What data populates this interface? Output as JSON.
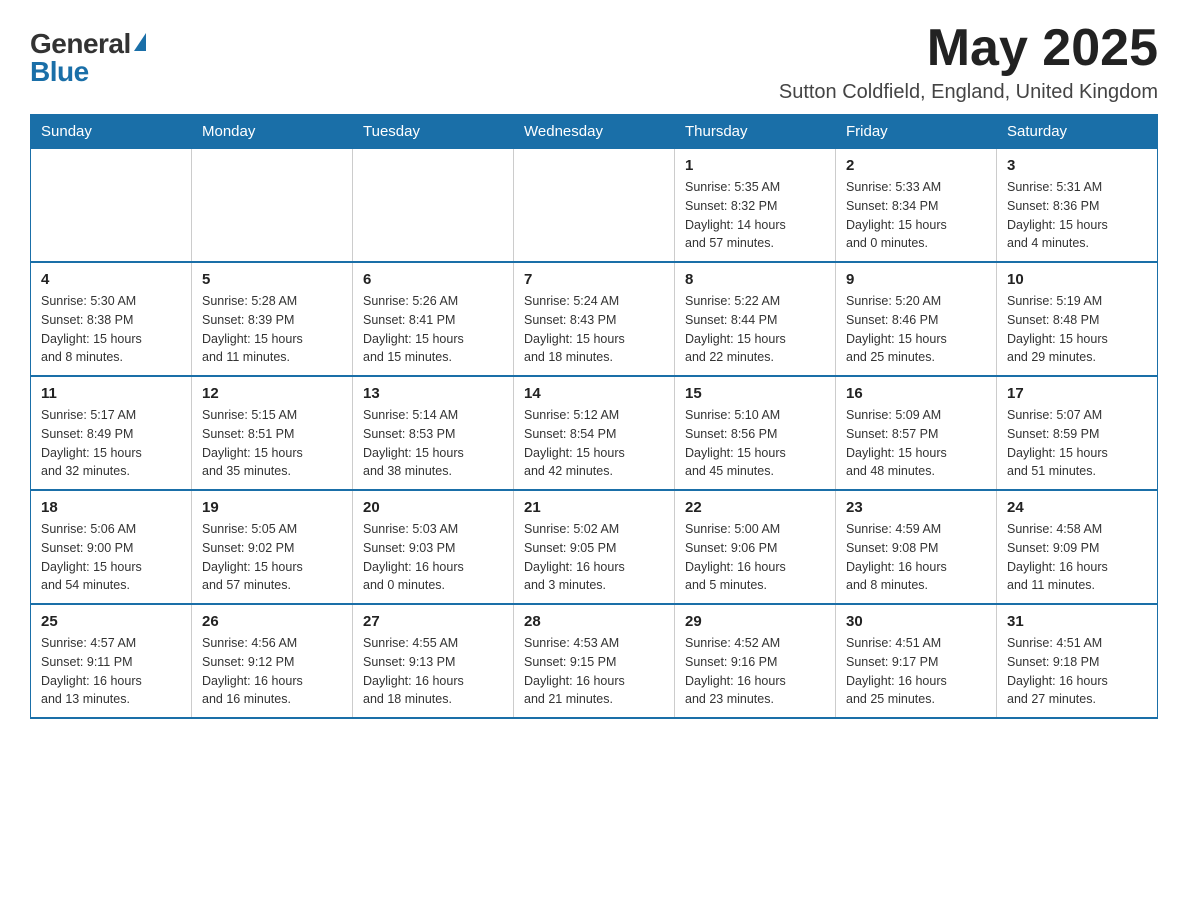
{
  "header": {
    "logo_line1": "General",
    "logo_line2": "Blue",
    "month": "May 2025",
    "location": "Sutton Coldfield, England, United Kingdom"
  },
  "weekdays": [
    "Sunday",
    "Monday",
    "Tuesday",
    "Wednesday",
    "Thursday",
    "Friday",
    "Saturday"
  ],
  "weeks": [
    [
      {
        "day": "",
        "info": ""
      },
      {
        "day": "",
        "info": ""
      },
      {
        "day": "",
        "info": ""
      },
      {
        "day": "",
        "info": ""
      },
      {
        "day": "1",
        "info": "Sunrise: 5:35 AM\nSunset: 8:32 PM\nDaylight: 14 hours\nand 57 minutes."
      },
      {
        "day": "2",
        "info": "Sunrise: 5:33 AM\nSunset: 8:34 PM\nDaylight: 15 hours\nand 0 minutes."
      },
      {
        "day": "3",
        "info": "Sunrise: 5:31 AM\nSunset: 8:36 PM\nDaylight: 15 hours\nand 4 minutes."
      }
    ],
    [
      {
        "day": "4",
        "info": "Sunrise: 5:30 AM\nSunset: 8:38 PM\nDaylight: 15 hours\nand 8 minutes."
      },
      {
        "day": "5",
        "info": "Sunrise: 5:28 AM\nSunset: 8:39 PM\nDaylight: 15 hours\nand 11 minutes."
      },
      {
        "day": "6",
        "info": "Sunrise: 5:26 AM\nSunset: 8:41 PM\nDaylight: 15 hours\nand 15 minutes."
      },
      {
        "day": "7",
        "info": "Sunrise: 5:24 AM\nSunset: 8:43 PM\nDaylight: 15 hours\nand 18 minutes."
      },
      {
        "day": "8",
        "info": "Sunrise: 5:22 AM\nSunset: 8:44 PM\nDaylight: 15 hours\nand 22 minutes."
      },
      {
        "day": "9",
        "info": "Sunrise: 5:20 AM\nSunset: 8:46 PM\nDaylight: 15 hours\nand 25 minutes."
      },
      {
        "day": "10",
        "info": "Sunrise: 5:19 AM\nSunset: 8:48 PM\nDaylight: 15 hours\nand 29 minutes."
      }
    ],
    [
      {
        "day": "11",
        "info": "Sunrise: 5:17 AM\nSunset: 8:49 PM\nDaylight: 15 hours\nand 32 minutes."
      },
      {
        "day": "12",
        "info": "Sunrise: 5:15 AM\nSunset: 8:51 PM\nDaylight: 15 hours\nand 35 minutes."
      },
      {
        "day": "13",
        "info": "Sunrise: 5:14 AM\nSunset: 8:53 PM\nDaylight: 15 hours\nand 38 minutes."
      },
      {
        "day": "14",
        "info": "Sunrise: 5:12 AM\nSunset: 8:54 PM\nDaylight: 15 hours\nand 42 minutes."
      },
      {
        "day": "15",
        "info": "Sunrise: 5:10 AM\nSunset: 8:56 PM\nDaylight: 15 hours\nand 45 minutes."
      },
      {
        "day": "16",
        "info": "Sunrise: 5:09 AM\nSunset: 8:57 PM\nDaylight: 15 hours\nand 48 minutes."
      },
      {
        "day": "17",
        "info": "Sunrise: 5:07 AM\nSunset: 8:59 PM\nDaylight: 15 hours\nand 51 minutes."
      }
    ],
    [
      {
        "day": "18",
        "info": "Sunrise: 5:06 AM\nSunset: 9:00 PM\nDaylight: 15 hours\nand 54 minutes."
      },
      {
        "day": "19",
        "info": "Sunrise: 5:05 AM\nSunset: 9:02 PM\nDaylight: 15 hours\nand 57 minutes."
      },
      {
        "day": "20",
        "info": "Sunrise: 5:03 AM\nSunset: 9:03 PM\nDaylight: 16 hours\nand 0 minutes."
      },
      {
        "day": "21",
        "info": "Sunrise: 5:02 AM\nSunset: 9:05 PM\nDaylight: 16 hours\nand 3 minutes."
      },
      {
        "day": "22",
        "info": "Sunrise: 5:00 AM\nSunset: 9:06 PM\nDaylight: 16 hours\nand 5 minutes."
      },
      {
        "day": "23",
        "info": "Sunrise: 4:59 AM\nSunset: 9:08 PM\nDaylight: 16 hours\nand 8 minutes."
      },
      {
        "day": "24",
        "info": "Sunrise: 4:58 AM\nSunset: 9:09 PM\nDaylight: 16 hours\nand 11 minutes."
      }
    ],
    [
      {
        "day": "25",
        "info": "Sunrise: 4:57 AM\nSunset: 9:11 PM\nDaylight: 16 hours\nand 13 minutes."
      },
      {
        "day": "26",
        "info": "Sunrise: 4:56 AM\nSunset: 9:12 PM\nDaylight: 16 hours\nand 16 minutes."
      },
      {
        "day": "27",
        "info": "Sunrise: 4:55 AM\nSunset: 9:13 PM\nDaylight: 16 hours\nand 18 minutes."
      },
      {
        "day": "28",
        "info": "Sunrise: 4:53 AM\nSunset: 9:15 PM\nDaylight: 16 hours\nand 21 minutes."
      },
      {
        "day": "29",
        "info": "Sunrise: 4:52 AM\nSunset: 9:16 PM\nDaylight: 16 hours\nand 23 minutes."
      },
      {
        "day": "30",
        "info": "Sunrise: 4:51 AM\nSunset: 9:17 PM\nDaylight: 16 hours\nand 25 minutes."
      },
      {
        "day": "31",
        "info": "Sunrise: 4:51 AM\nSunset: 9:18 PM\nDaylight: 16 hours\nand 27 minutes."
      }
    ]
  ]
}
